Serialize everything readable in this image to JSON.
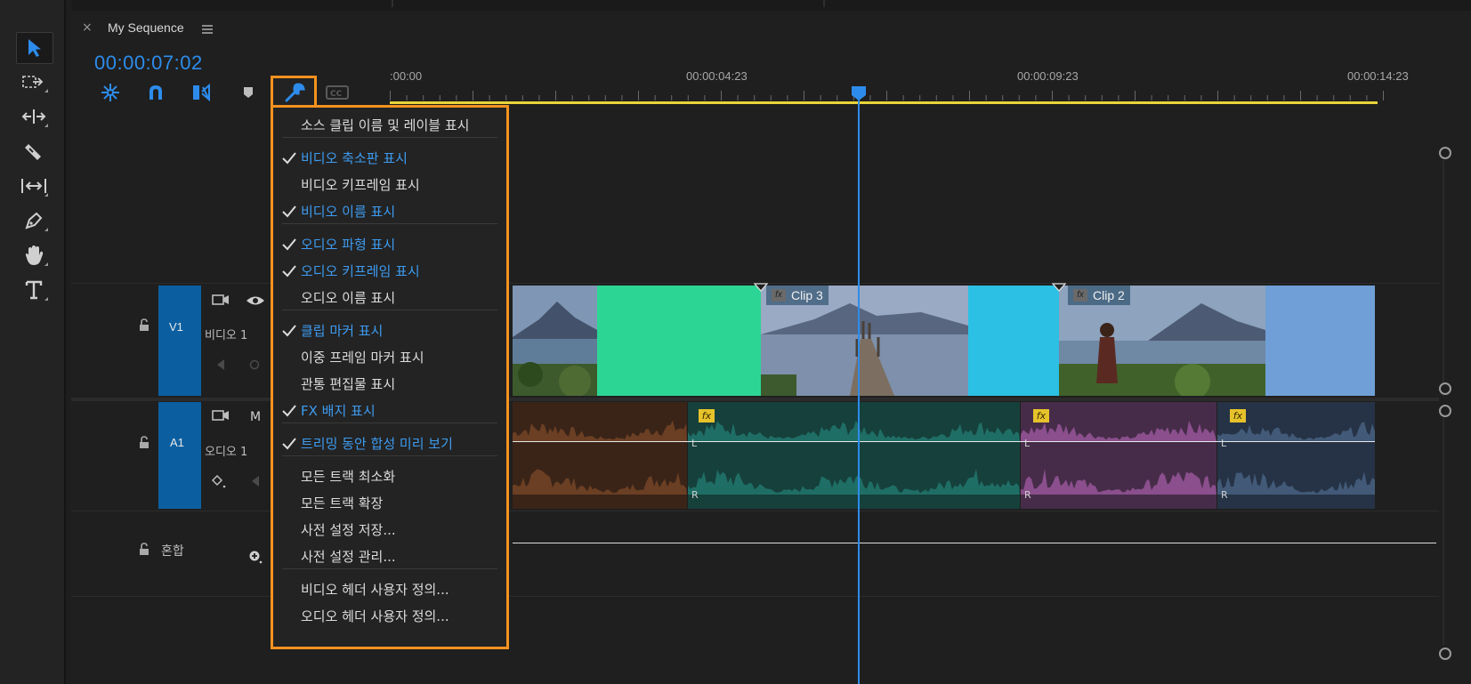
{
  "sequence": {
    "tab_title": "My Sequence",
    "close_glyph": "×",
    "timecode": "00:00:07:02"
  },
  "ruler": {
    "labels": [
      ":00:00",
      "00:00:04:23",
      "00:00:09:23",
      "00:00:14:23"
    ]
  },
  "tracks": {
    "v1": {
      "id": "V1",
      "name": "비디오 1"
    },
    "a1": {
      "id": "A1",
      "name": "오디오 1"
    },
    "mix": {
      "name": "혼합"
    },
    "a1_extra": "M"
  },
  "clips": {
    "clip3": "Clip 3",
    "clip2": "Clip 2",
    "fx_glyph": "fx",
    "lr": {
      "l": "L",
      "r": "R"
    }
  },
  "menu": {
    "items": [
      {
        "label": "소스 클립 이름 및 레이블 표시",
        "checked": false
      },
      {
        "label": "비디오 축소판 표시",
        "checked": true
      },
      {
        "label": "비디오 키프레임 표시",
        "checked": false
      },
      {
        "label": "비디오 이름 표시",
        "checked": true
      },
      {
        "label": "오디오 파형 표시",
        "checked": true
      },
      {
        "label": "오디오 키프레임 표시",
        "checked": true
      },
      {
        "label": "오디오 이름 표시",
        "checked": false
      },
      {
        "label": "클립 마커 표시",
        "checked": true
      },
      {
        "label": "이중 프레임 마커 표시",
        "checked": false
      },
      {
        "label": "관통 편집물 표시",
        "checked": false
      },
      {
        "label": "FX 배지 표시",
        "checked": true
      },
      {
        "label": "트리밍 동안 합성 미리 보기",
        "checked": true
      },
      {
        "label": "모든 트랙 최소화",
        "checked": false
      },
      {
        "label": "모든 트랙 확장",
        "checked": false
      },
      {
        "label": "사전 설정 저장...",
        "checked": false
      },
      {
        "label": "사전 설정 관리...",
        "checked": false
      },
      {
        "label": "비디오 헤더 사용자 정의...",
        "checked": false
      },
      {
        "label": "오디오 헤더 사용자 정의...",
        "checked": false
      }
    ]
  },
  "tools": [
    "selection-tool",
    "track-select-tool",
    "ripple-edit-tool",
    "razor-tool",
    "slip-tool",
    "pen-tool",
    "hand-tool",
    "type-tool"
  ],
  "colors": {
    "accent": "#2d8ceb",
    "highlight": "#f4921f",
    "checked_text": "#3d9bf0",
    "work_area": "#e8d43a"
  }
}
